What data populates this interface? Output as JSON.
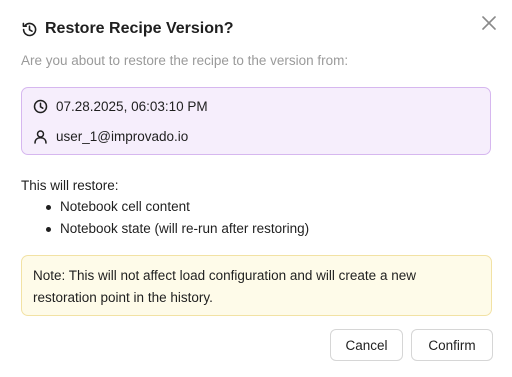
{
  "dialog": {
    "title": "Restore Recipe Version?",
    "title_icon": "history-icon",
    "close_icon": "close-icon",
    "subtitle": "Are you about to restore the recipe to the version from:"
  },
  "version": {
    "timestamp": "07.28.2025, 06:03:10 PM",
    "timestamp_icon": "clock-icon",
    "user": "user_1@improvado.io",
    "user_icon": "user-icon",
    "accent_bg": "#f6eefc",
    "accent_border": "#d6b7ef"
  },
  "restore": {
    "heading": "This will restore:",
    "items": [
      "Notebook cell content",
      "Notebook state (will re-run after restoring)"
    ]
  },
  "note": {
    "text": "Note: This will not affect load configuration and will create a new restoration point in the history.",
    "bg": "#fefbe9",
    "border": "#f2e2a4"
  },
  "buttons": {
    "cancel": "Cancel",
    "confirm": "Confirm"
  }
}
